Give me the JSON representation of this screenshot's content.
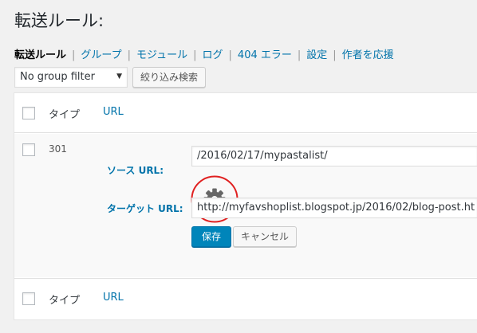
{
  "page": {
    "title": "転送ルール:"
  },
  "subnav": {
    "items": [
      {
        "label": "転送ルール"
      },
      {
        "label": "グループ"
      },
      {
        "label": "モジュール"
      },
      {
        "label": "ログ"
      },
      {
        "label": "404 エラー"
      },
      {
        "label": "設定"
      },
      {
        "label": "作者を応援"
      }
    ],
    "separator": "|"
  },
  "filter": {
    "group_select": "No group filter",
    "button": "絞り込み検索"
  },
  "table": {
    "header": {
      "type": "タイプ",
      "url": "URL"
    },
    "footer": {
      "type": "タイプ",
      "url": "URL"
    },
    "row": {
      "code": "301",
      "source_label": "ソース URL:",
      "source_value": "/2016/02/17/mypastalist/",
      "target_label": "ターゲット URL:",
      "target_value": "http://myfavshoplist.blogspot.jp/2016/02/blog-post.ht",
      "save_label": "保存",
      "cancel_label": "キャンセル"
    }
  },
  "colors": {
    "accent": "#0073aa",
    "primary_button": "#0085ba",
    "highlight_circle": "#e02020",
    "gear": "#666666"
  },
  "icons": {
    "gear": "gear-icon",
    "dropdown": "chevron-down-icon"
  }
}
